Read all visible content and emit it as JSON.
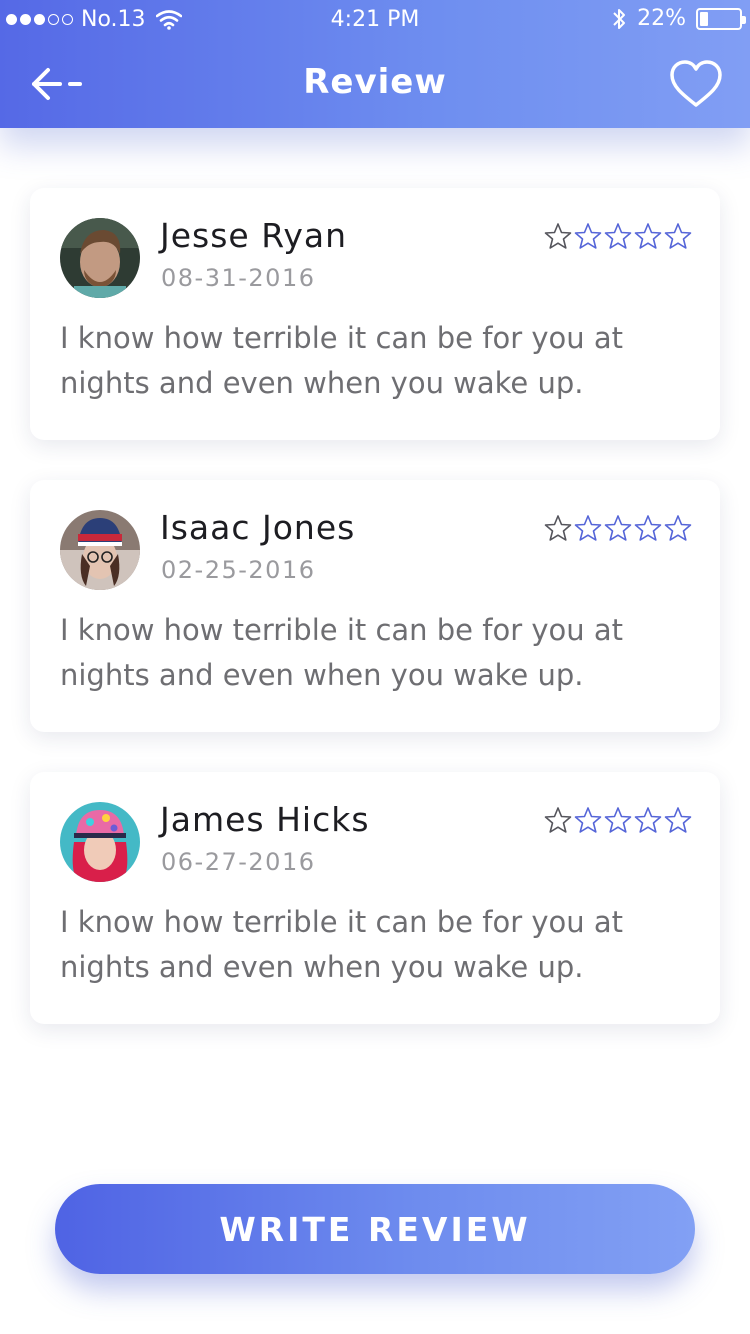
{
  "status_bar": {
    "carrier": "No.13",
    "time": "4:21 PM",
    "battery_percent": "22%",
    "battery_level": 0.22,
    "signal_bars_filled": 3,
    "signal_bars_total": 5,
    "icons": [
      "wifi-icon",
      "bluetooth-icon",
      "battery-icon"
    ]
  },
  "header": {
    "title": "Review",
    "back_icon": "arrow-left-icon",
    "favorite_icon": "heart-outline-icon",
    "gradient": [
      "#5569e6",
      "#819ef4"
    ]
  },
  "reviews": [
    {
      "name": "Jesse Ryan",
      "date": "08-31-2016",
      "text": "I know how terrible it can be for you at nights and even when you wake up.",
      "rating": 0,
      "max_rating": 5
    },
    {
      "name": "Isaac Jones",
      "date": "02-25-2016",
      "text": "I know how terrible it can be for you at nights and even when you wake up.",
      "rating": 0,
      "max_rating": 5
    },
    {
      "name": "James Hicks",
      "date": "06-27-2016",
      "text": "I know how terrible it can be for you at nights and even when you wake up.",
      "rating": 0,
      "max_rating": 5
    }
  ],
  "write_review_button": {
    "label": "WRITE REVIEW"
  },
  "colors": {
    "accent": "#5a6fe8",
    "star_outline": "#5565d8",
    "name_text": "#1d1d22",
    "date_text": "#9a9a9e",
    "body_text": "#6e6e72"
  }
}
